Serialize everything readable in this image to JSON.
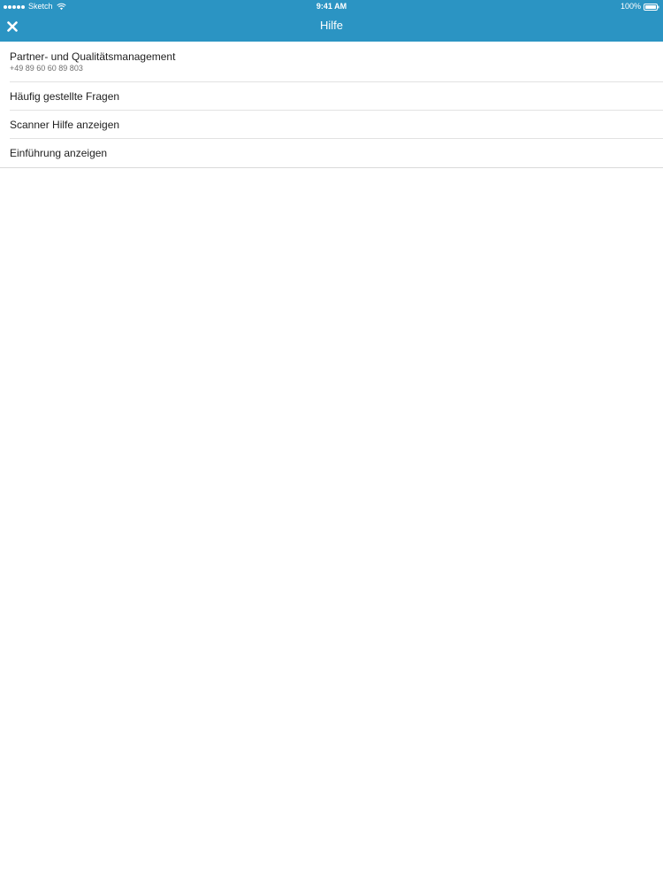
{
  "status_bar": {
    "carrier": "Sketch",
    "time": "9:41 AM",
    "battery_percent": "100%",
    "signal_bars": 5
  },
  "nav": {
    "title": "Hilfe",
    "close_icon": "close-icon"
  },
  "list": {
    "contact": {
      "title": "Partner- und Qualitätsmanagement",
      "phone": "+49 89 60 60 89 803"
    },
    "faq": "Häufig gestellte Fragen",
    "scanner_help": "Scanner Hilfe anzeigen",
    "intro": "Einführung anzeigen"
  },
  "colors": {
    "header": "#2b94c3",
    "text": "#1e1e1e",
    "subtext": "#6f6f6f",
    "separator": "#e2e2e2"
  }
}
